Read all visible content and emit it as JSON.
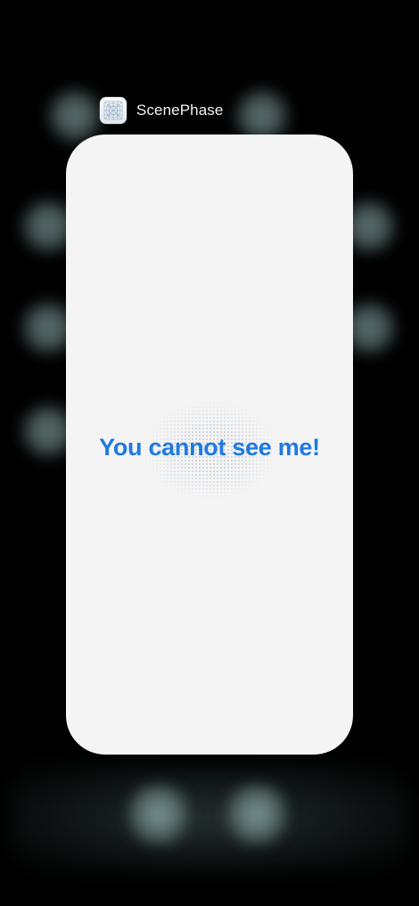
{
  "app_switcher": {
    "app_name": "ScenePhase",
    "app_icon": "scenephase-app-icon"
  },
  "card": {
    "message": "You cannot see me!"
  },
  "colors": {
    "background": "#000000",
    "card_background": "#f4f4f4",
    "message_text": "#1f7ae0",
    "app_name_text": "#f2f2f2"
  }
}
